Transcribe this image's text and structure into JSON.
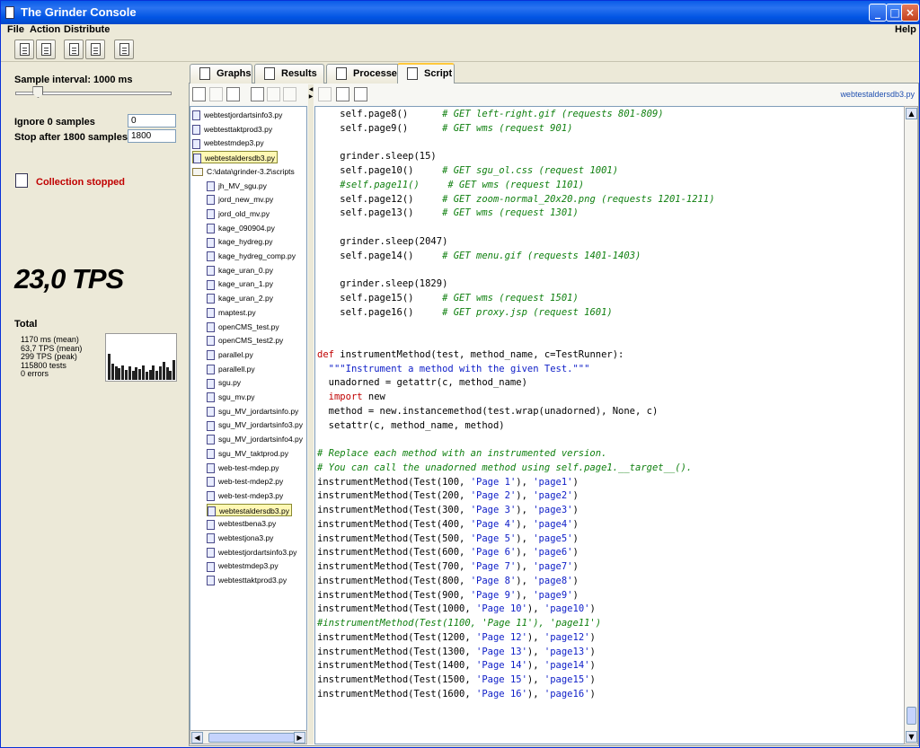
{
  "window": {
    "title": "The Grinder Console"
  },
  "menu": {
    "file": "File",
    "action": "Action",
    "distribute": "Distribute",
    "help": "Help"
  },
  "sampling": {
    "interval_label": "Sample interval: 1000 ms",
    "interval_fraction": 0.12,
    "ignore_label": "Ignore 0 samples",
    "ignore_value": "0",
    "stop_label": "Stop after 1800 samples",
    "stop_value": "1800"
  },
  "status": {
    "text": "Collection stopped",
    "color": "#c00000"
  },
  "tps": "23,0 TPS",
  "total": {
    "title": "Total",
    "stats": [
      "1170 ms (mean)",
      "63,7 TPS (mean)",
      "299 TPS (peak)",
      "115800 tests",
      "0 errors"
    ],
    "graph_values": [
      0.55,
      0.35,
      0.28,
      0.25,
      0.3,
      0.22,
      0.28,
      0.2,
      0.26,
      0.24,
      0.3,
      0.18,
      0.22,
      0.3,
      0.2,
      0.28,
      0.38,
      0.26,
      0.2,
      0.42
    ]
  },
  "tabs": [
    {
      "label": "Graphs",
      "active": false
    },
    {
      "label": "Results",
      "active": false
    },
    {
      "label": "Processes",
      "active": false
    },
    {
      "label": "Script",
      "active": true
    }
  ],
  "tree": {
    "open_files": [
      "webtestjordartsinfo3.py",
      "webtesttaktprod3.py",
      "webtestmdep3.py",
      "webtestaldersdb3.py"
    ],
    "folder": "C:\\data\\grinder-3.2\\scripts",
    "files": [
      "jh_MV_sgu.py",
      "jord_new_mv.py",
      "jord_old_mv.py",
      "kage_090904.py",
      "kage_hydreg.py",
      "kage_hydreg_comp.py",
      "kage_uran_0.py",
      "kage_uran_1.py",
      "kage_uran_2.py",
      "maptest.py",
      "openCMS_test.py",
      "openCMS_test2.py",
      "parallel.py",
      "parallell.py",
      "sgu.py",
      "sgu_mv.py",
      "sgu_MV_jordartsinfo.py",
      "sgu_MV_jordartsinfo3.py",
      "sgu_MV_jordartsinfo4.py",
      "sgu_MV_taktprod.py",
      "web-test-mdep.py",
      "web-test-mdep2.py",
      "web-test-mdep3.py",
      "webtestaldersdb3.py",
      "webtestbena3.py",
      "webtestjona3.py",
      "webtestjordartsinfo3.py",
      "webtestmdep3.py",
      "webtesttaktprod3.py"
    ],
    "highlighted": "webtestaldersdb3.py"
  },
  "editor": {
    "filename": "webtestaldersdb3.py",
    "lines": [
      [
        [
          "    self.page8()      ",
          ""
        ],
        [
          "# GET left-right.gif (requests 801-809)",
          "cm"
        ]
      ],
      [
        [
          "    self.page9()      ",
          ""
        ],
        [
          "# GET wms (request 901)",
          "cm"
        ]
      ],
      [
        [
          "",
          ""
        ]
      ],
      [
        [
          "    grinder.sleep(15)",
          ""
        ]
      ],
      [
        [
          "    self.page10()     ",
          ""
        ],
        [
          "# GET sgu_ol.css (request 1001)",
          "cm"
        ]
      ],
      [
        [
          "    ",
          ""
        ],
        [
          "#self.page11()     # GET wms (request 1101)",
          "cm"
        ]
      ],
      [
        [
          "    self.page12()     ",
          ""
        ],
        [
          "# GET zoom-normal_20x20.png (requests 1201-1211)",
          "cm"
        ]
      ],
      [
        [
          "    self.page13()     ",
          ""
        ],
        [
          "# GET wms (request 1301)",
          "cm"
        ]
      ],
      [
        [
          "",
          ""
        ]
      ],
      [
        [
          "    grinder.sleep(2047)",
          ""
        ]
      ],
      [
        [
          "    self.page14()     ",
          ""
        ],
        [
          "# GET menu.gif (requests 1401-1403)",
          "cm"
        ]
      ],
      [
        [
          "",
          ""
        ]
      ],
      [
        [
          "    grinder.sleep(1829)",
          ""
        ]
      ],
      [
        [
          "    self.page15()     ",
          ""
        ],
        [
          "# GET wms (request 1501)",
          "cm"
        ]
      ],
      [
        [
          "    self.page16()     ",
          ""
        ],
        [
          "# GET proxy.jsp (request 1601)",
          "cm"
        ]
      ],
      [
        [
          "",
          ""
        ]
      ],
      [
        [
          "",
          ""
        ]
      ],
      [
        [
          "def",
          "kw"
        ],
        [
          " instrumentMethod(test, method_name, c=TestRunner):",
          ""
        ]
      ],
      [
        [
          "  ",
          ""
        ],
        [
          "\"\"\"Instrument a method with the given Test.\"\"\"",
          "str"
        ]
      ],
      [
        [
          "  unadorned = getattr(c, method_name)",
          ""
        ]
      ],
      [
        [
          "  ",
          ""
        ],
        [
          "import",
          "kw"
        ],
        [
          " new",
          ""
        ]
      ],
      [
        [
          "  method = new.instancemethod(test.wrap(unadorned), None, c)",
          ""
        ]
      ],
      [
        [
          "  setattr(c, method_name, method)",
          ""
        ]
      ],
      [
        [
          "",
          ""
        ]
      ],
      [
        [
          "# Replace each method with an instrumented version.",
          "cm"
        ]
      ],
      [
        [
          "# You can call the unadorned method using self.page1.__target__().",
          "cm"
        ]
      ],
      [
        [
          "instrumentMethod(Test(100, ",
          ""
        ],
        [
          "'Page 1'",
          "str"
        ],
        [
          "), ",
          ""
        ],
        [
          "'page1'",
          "str"
        ],
        [
          ")",
          ""
        ]
      ],
      [
        [
          "instrumentMethod(Test(200, ",
          ""
        ],
        [
          "'Page 2'",
          "str"
        ],
        [
          "), ",
          ""
        ],
        [
          "'page2'",
          "str"
        ],
        [
          ")",
          ""
        ]
      ],
      [
        [
          "instrumentMethod(Test(300, ",
          ""
        ],
        [
          "'Page 3'",
          "str"
        ],
        [
          "), ",
          ""
        ],
        [
          "'page3'",
          "str"
        ],
        [
          ")",
          ""
        ]
      ],
      [
        [
          "instrumentMethod(Test(400, ",
          ""
        ],
        [
          "'Page 4'",
          "str"
        ],
        [
          "), ",
          ""
        ],
        [
          "'page4'",
          "str"
        ],
        [
          ")",
          ""
        ]
      ],
      [
        [
          "instrumentMethod(Test(500, ",
          ""
        ],
        [
          "'Page 5'",
          "str"
        ],
        [
          "), ",
          ""
        ],
        [
          "'page5'",
          "str"
        ],
        [
          ")",
          ""
        ]
      ],
      [
        [
          "instrumentMethod(Test(600, ",
          ""
        ],
        [
          "'Page 6'",
          "str"
        ],
        [
          "), ",
          ""
        ],
        [
          "'page6'",
          "str"
        ],
        [
          ")",
          ""
        ]
      ],
      [
        [
          "instrumentMethod(Test(700, ",
          ""
        ],
        [
          "'Page 7'",
          "str"
        ],
        [
          "), ",
          ""
        ],
        [
          "'page7'",
          "str"
        ],
        [
          ")",
          ""
        ]
      ],
      [
        [
          "instrumentMethod(Test(800, ",
          ""
        ],
        [
          "'Page 8'",
          "str"
        ],
        [
          "), ",
          ""
        ],
        [
          "'page8'",
          "str"
        ],
        [
          ")",
          ""
        ]
      ],
      [
        [
          "instrumentMethod(Test(900, ",
          ""
        ],
        [
          "'Page 9'",
          "str"
        ],
        [
          "), ",
          ""
        ],
        [
          "'page9'",
          "str"
        ],
        [
          ")",
          ""
        ]
      ],
      [
        [
          "instrumentMethod(Test(1000, ",
          ""
        ],
        [
          "'Page 10'",
          "str"
        ],
        [
          "), ",
          ""
        ],
        [
          "'page10'",
          "str"
        ],
        [
          ")",
          ""
        ]
      ],
      [
        [
          "#instrumentMethod(Test(1100, 'Page 11'), 'page11')",
          "cm"
        ]
      ],
      [
        [
          "instrumentMethod(Test(1200, ",
          ""
        ],
        [
          "'Page 12'",
          "str"
        ],
        [
          "), ",
          ""
        ],
        [
          "'page12'",
          "str"
        ],
        [
          ")",
          ""
        ]
      ],
      [
        [
          "instrumentMethod(Test(1300, ",
          ""
        ],
        [
          "'Page 13'",
          "str"
        ],
        [
          "), ",
          ""
        ],
        [
          "'page13'",
          "str"
        ],
        [
          ")",
          ""
        ]
      ],
      [
        [
          "instrumentMethod(Test(1400, ",
          ""
        ],
        [
          "'Page 14'",
          "str"
        ],
        [
          "), ",
          ""
        ],
        [
          "'page14'",
          "str"
        ],
        [
          ")",
          ""
        ]
      ],
      [
        [
          "instrumentMethod(Test(1500, ",
          ""
        ],
        [
          "'Page 15'",
          "str"
        ],
        [
          "), ",
          ""
        ],
        [
          "'page15'",
          "str"
        ],
        [
          ")",
          ""
        ]
      ],
      [
        [
          "instrumentMethod(Test(1600, ",
          ""
        ],
        [
          "'Page 16'",
          "str"
        ],
        [
          "), ",
          ""
        ],
        [
          "'page16'",
          "str"
        ],
        [
          ")",
          ""
        ]
      ]
    ]
  },
  "colors": {
    "titlebar": "#0255e4",
    "keyword": "#c00000",
    "string": "#1020c8",
    "comment": "#108010",
    "highlight": "#fff8b4"
  },
  "icons": {
    "toolbar": [
      "start-processes-icon",
      "reset-processes-icon",
      "start-capture-icon",
      "stop-capture-icon",
      "distribute-files-icon"
    ]
  }
}
